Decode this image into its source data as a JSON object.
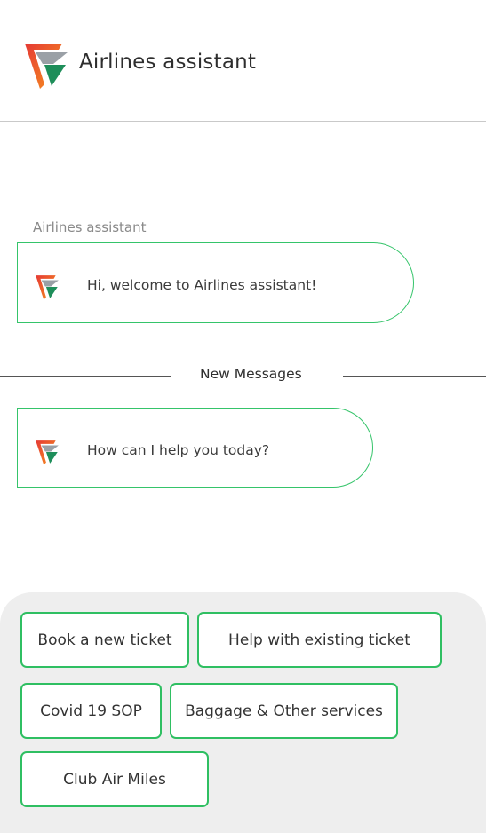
{
  "header": {
    "title": "Airlines assistant",
    "logo_icon": "airline-logo-icon"
  },
  "conversation": {
    "sender_name": "Airlines assistant",
    "messages": [
      {
        "text": "Hi, welcome to Airlines assistant!",
        "avatar_icon": "bot-avatar-icon"
      },
      {
        "text": "How can I help you today?",
        "avatar_icon": "bot-avatar-icon"
      }
    ],
    "divider_label": "New Messages"
  },
  "quick_replies": [
    {
      "label": "Book a new ticket"
    },
    {
      "label": "Help with existing ticket"
    },
    {
      "label": "Covid 19 SOP"
    },
    {
      "label": "Baggage & Other services"
    },
    {
      "label": "Club Air Miles"
    }
  ],
  "colors": {
    "accent_green": "#2fbf62",
    "logo_orange": "#f47a20",
    "logo_red": "#e53935",
    "logo_green": "#1e8e5a",
    "panel_bg": "#eeeeee"
  }
}
